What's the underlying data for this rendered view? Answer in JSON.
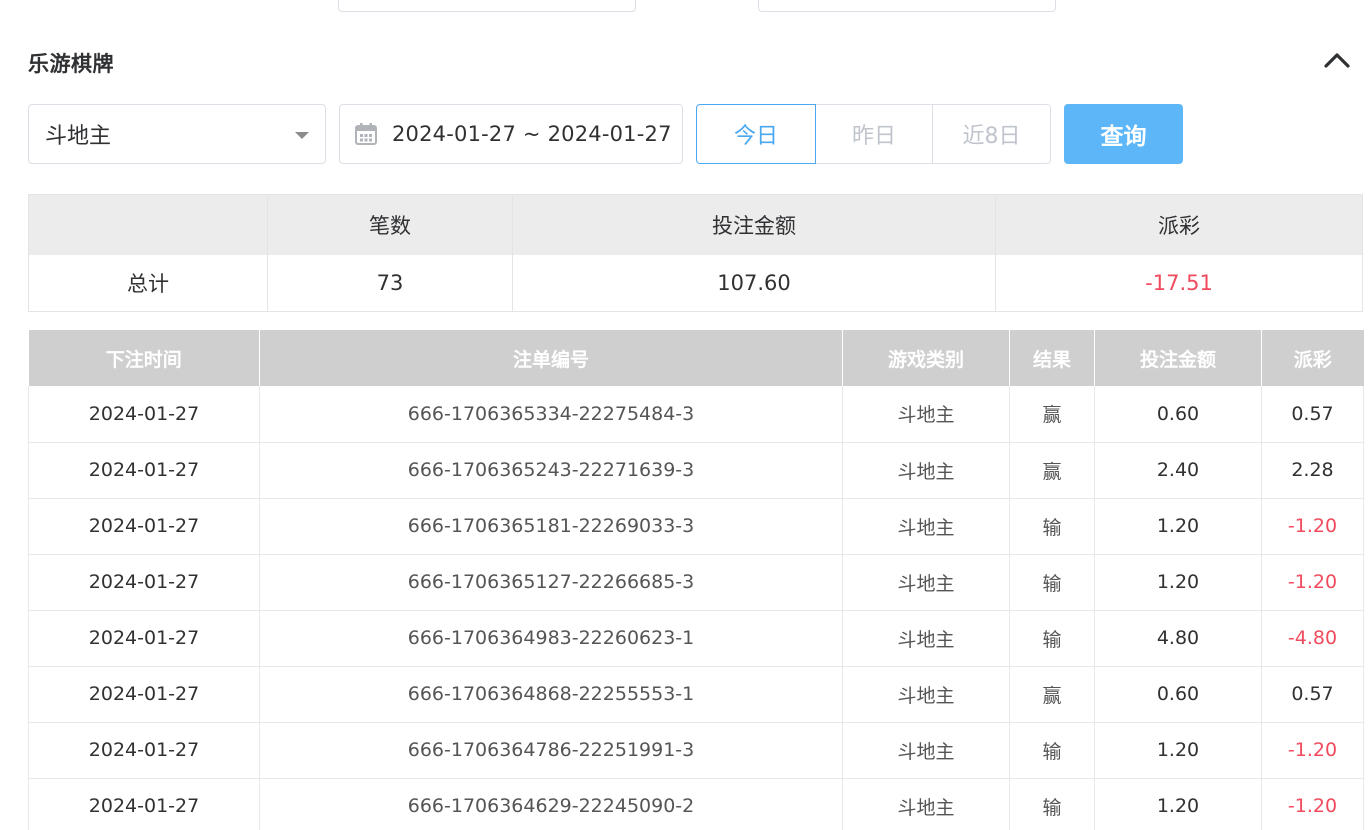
{
  "section": {
    "title": "乐游棋牌"
  },
  "filters": {
    "game_select": {
      "value": "斗地主"
    },
    "date_range": {
      "value": "2024-01-27 ~ 2024-01-27"
    },
    "range_buttons": [
      "今日",
      "昨日",
      "近8日"
    ],
    "active_range": "今日",
    "query_label": "查询"
  },
  "summary": {
    "headers": [
      "",
      "笔数",
      "投注金额",
      "派彩"
    ],
    "row": {
      "label": "总计",
      "count": "73",
      "bet": "107.60",
      "payout": "-17.51"
    }
  },
  "records": {
    "columns": [
      "下注时间",
      "注单编号",
      "游戏类别",
      "结果",
      "投注金额",
      "派彩"
    ],
    "rows": [
      {
        "time": "2024-01-27",
        "id": "666-1706365334-22275484-3",
        "game": "斗地主",
        "result": "赢",
        "bet": "0.60",
        "payout": "0.57"
      },
      {
        "time": "2024-01-27",
        "id": "666-1706365243-22271639-3",
        "game": "斗地主",
        "result": "赢",
        "bet": "2.40",
        "payout": "2.28"
      },
      {
        "time": "2024-01-27",
        "id": "666-1706365181-22269033-3",
        "game": "斗地主",
        "result": "输",
        "bet": "1.20",
        "payout": "-1.20"
      },
      {
        "time": "2024-01-27",
        "id": "666-1706365127-22266685-3",
        "game": "斗地主",
        "result": "输",
        "bet": "1.20",
        "payout": "-1.20"
      },
      {
        "time": "2024-01-27",
        "id": "666-1706364983-22260623-1",
        "game": "斗地主",
        "result": "输",
        "bet": "4.80",
        "payout": "-4.80"
      },
      {
        "time": "2024-01-27",
        "id": "666-1706364868-22255553-1",
        "game": "斗地主",
        "result": "赢",
        "bet": "0.60",
        "payout": "0.57"
      },
      {
        "time": "2024-01-27",
        "id": "666-1706364786-22251991-3",
        "game": "斗地主",
        "result": "输",
        "bet": "1.20",
        "payout": "-1.20"
      },
      {
        "time": "2024-01-27",
        "id": "666-1706364629-22245090-2",
        "game": "斗地主",
        "result": "输",
        "bet": "1.20",
        "payout": "-1.20"
      }
    ]
  },
  "colors": {
    "accent": "#4aa8f0",
    "query_button": "#5db6f7",
    "negative": "#f04b5e",
    "header_bg": "#cfcfcf"
  },
  "icons": {
    "collapse": "chevron-up-icon",
    "calendar": "calendar-icon",
    "select": "caret-down-icon"
  }
}
